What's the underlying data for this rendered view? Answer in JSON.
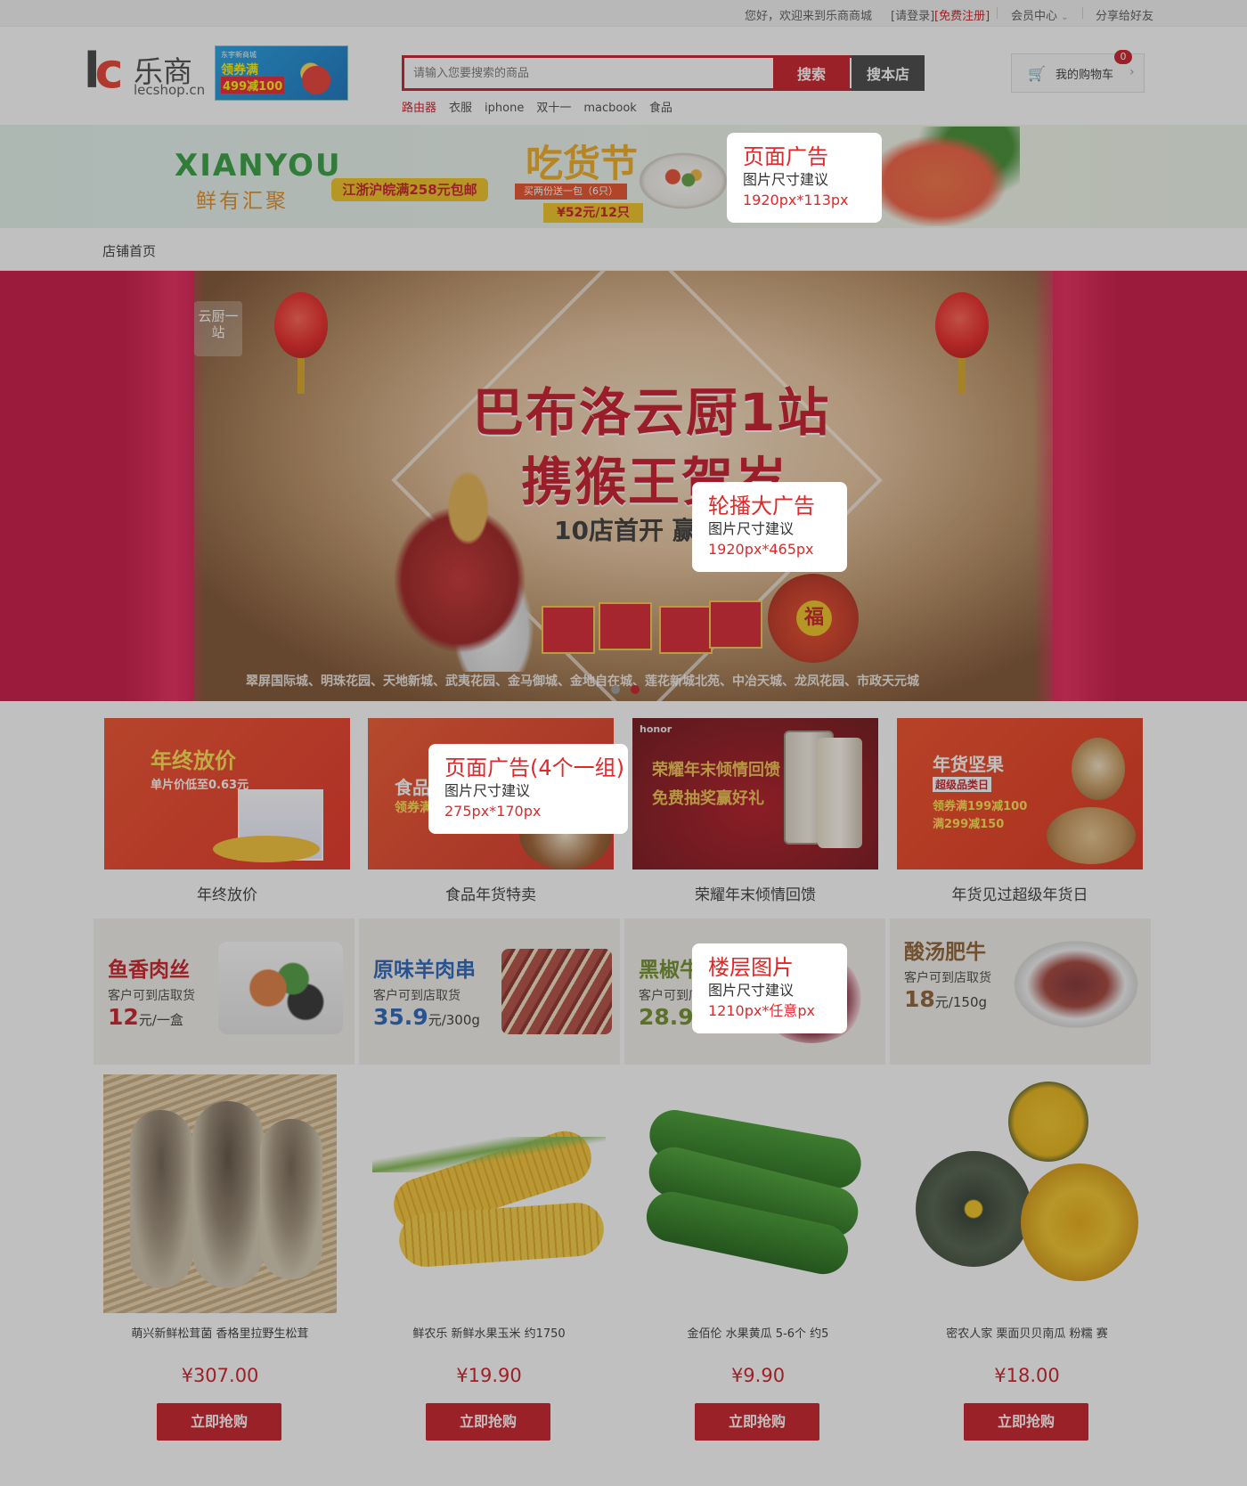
{
  "topbar": {
    "welcome": "您好，欢迎来到乐商商城",
    "login": "[请登录]",
    "register": "[免费注册]",
    "member_center": "会员中心",
    "share": "分享给好友"
  },
  "header": {
    "logo_cn": "乐商",
    "logo_en": "lecshop.cn",
    "logo_mark": "lc",
    "banner": {
      "line1": "东宇新商城",
      "line2": "领券满",
      "line3": "499减100"
    },
    "search": {
      "placeholder": "请输入您要搜索的商品",
      "search_label": "搜索",
      "store_search_label": "搜本店"
    },
    "hotwords": [
      "路由器",
      "衣服",
      "iphone",
      "双十一",
      "macbook",
      "食品"
    ],
    "cart": {
      "label": "我的购物车",
      "count": "0"
    }
  },
  "page_ad": {
    "brand": "XIANYOU",
    "brand_cn": "鲜有汇聚",
    "tag": "江浙沪皖满258元包邮",
    "festival": "吃货节",
    "offer": "买两份送一包（6只）",
    "price": "¥52元/12只"
  },
  "store_nav": {
    "home": "店铺首页"
  },
  "carousel": {
    "line1": "巴布洛云厨1站",
    "line2": "携猴王贺岁",
    "line3": "10店首开 赢战",
    "corner": "云厨一站",
    "footer": "翠屏国际城、明珠花园、天地新城、武夷花园、金马御城、金地自在城、莲花新城北苑、中冶天城、龙凤花园、市政天元城",
    "fu": "福"
  },
  "promos": [
    {
      "title": "年终放价",
      "sub": "单片价低至0.63元",
      "caption": "年终放价"
    },
    {
      "title": "食品年货",
      "sub": "领券满减",
      "caption": "食品年货特卖"
    },
    {
      "title": "荣耀年末倾情回馈",
      "sub": "免费抽奖赢好礼",
      "caption": "荣耀年末倾情回馈",
      "brand": "honor"
    },
    {
      "title": "年货坚果",
      "sub": "超级品类日",
      "line1": "领券满199减100",
      "line2": "满299减150",
      "caption": "年货见过超级年货日"
    }
  ],
  "floors": [
    {
      "title": "鱼香肉丝",
      "note": "客户可到店取货",
      "price": "12",
      "unit": "元/一盒",
      "color": "#c8161e"
    },
    {
      "title": "原味羊肉串",
      "note": "客户可到店取货",
      "price": "35.9",
      "unit": "元/300g",
      "color": "#1f5fb8"
    },
    {
      "title": "黑椒牛",
      "note": "客户可到店取货",
      "price": "28.9",
      "unit": "元",
      "color": "#6a8a1f"
    },
    {
      "title": "酸汤肥牛",
      "note": "客户可到店取货",
      "price": "18",
      "unit": "元/150g",
      "color": "#8a5a2a"
    }
  ],
  "products": [
    {
      "name": "萌兴新鲜松茸菌 香格里拉野生松茸",
      "price": "¥307.00",
      "button": "立即抢购"
    },
    {
      "name": "鲜农乐 新鲜水果玉米 约1750",
      "price": "¥19.90",
      "button": "立即抢购"
    },
    {
      "name": "金佰伦 水果黄瓜 5-6个 约5",
      "price": "¥9.90",
      "button": "立即抢购"
    },
    {
      "name": "密农人家 栗面贝贝南瓜 粉糯 赛",
      "price": "¥18.00",
      "button": "立即抢购"
    }
  ],
  "callouts": [
    {
      "title": "页面广告",
      "sub": "图片尺寸建议",
      "size": "1920px*113px"
    },
    {
      "title": "轮播大广告",
      "sub": "图片尺寸建议",
      "size": "1920px*465px"
    },
    {
      "title": "页面广告(4个一组)",
      "sub": "图片尺寸建议",
      "size": "275px*170px"
    },
    {
      "title": "楼层图片",
      "sub": "图片尺寸建议",
      "size": "1210px*任意px"
    }
  ],
  "colors": {
    "accent": "#c8161e",
    "overlay": "rgba(60,60,60,0.32)",
    "carousel_bg": "#d01145"
  },
  "icons": [
    "cart-icon",
    "chevron-down-icon",
    "chevron-right-icon"
  ]
}
